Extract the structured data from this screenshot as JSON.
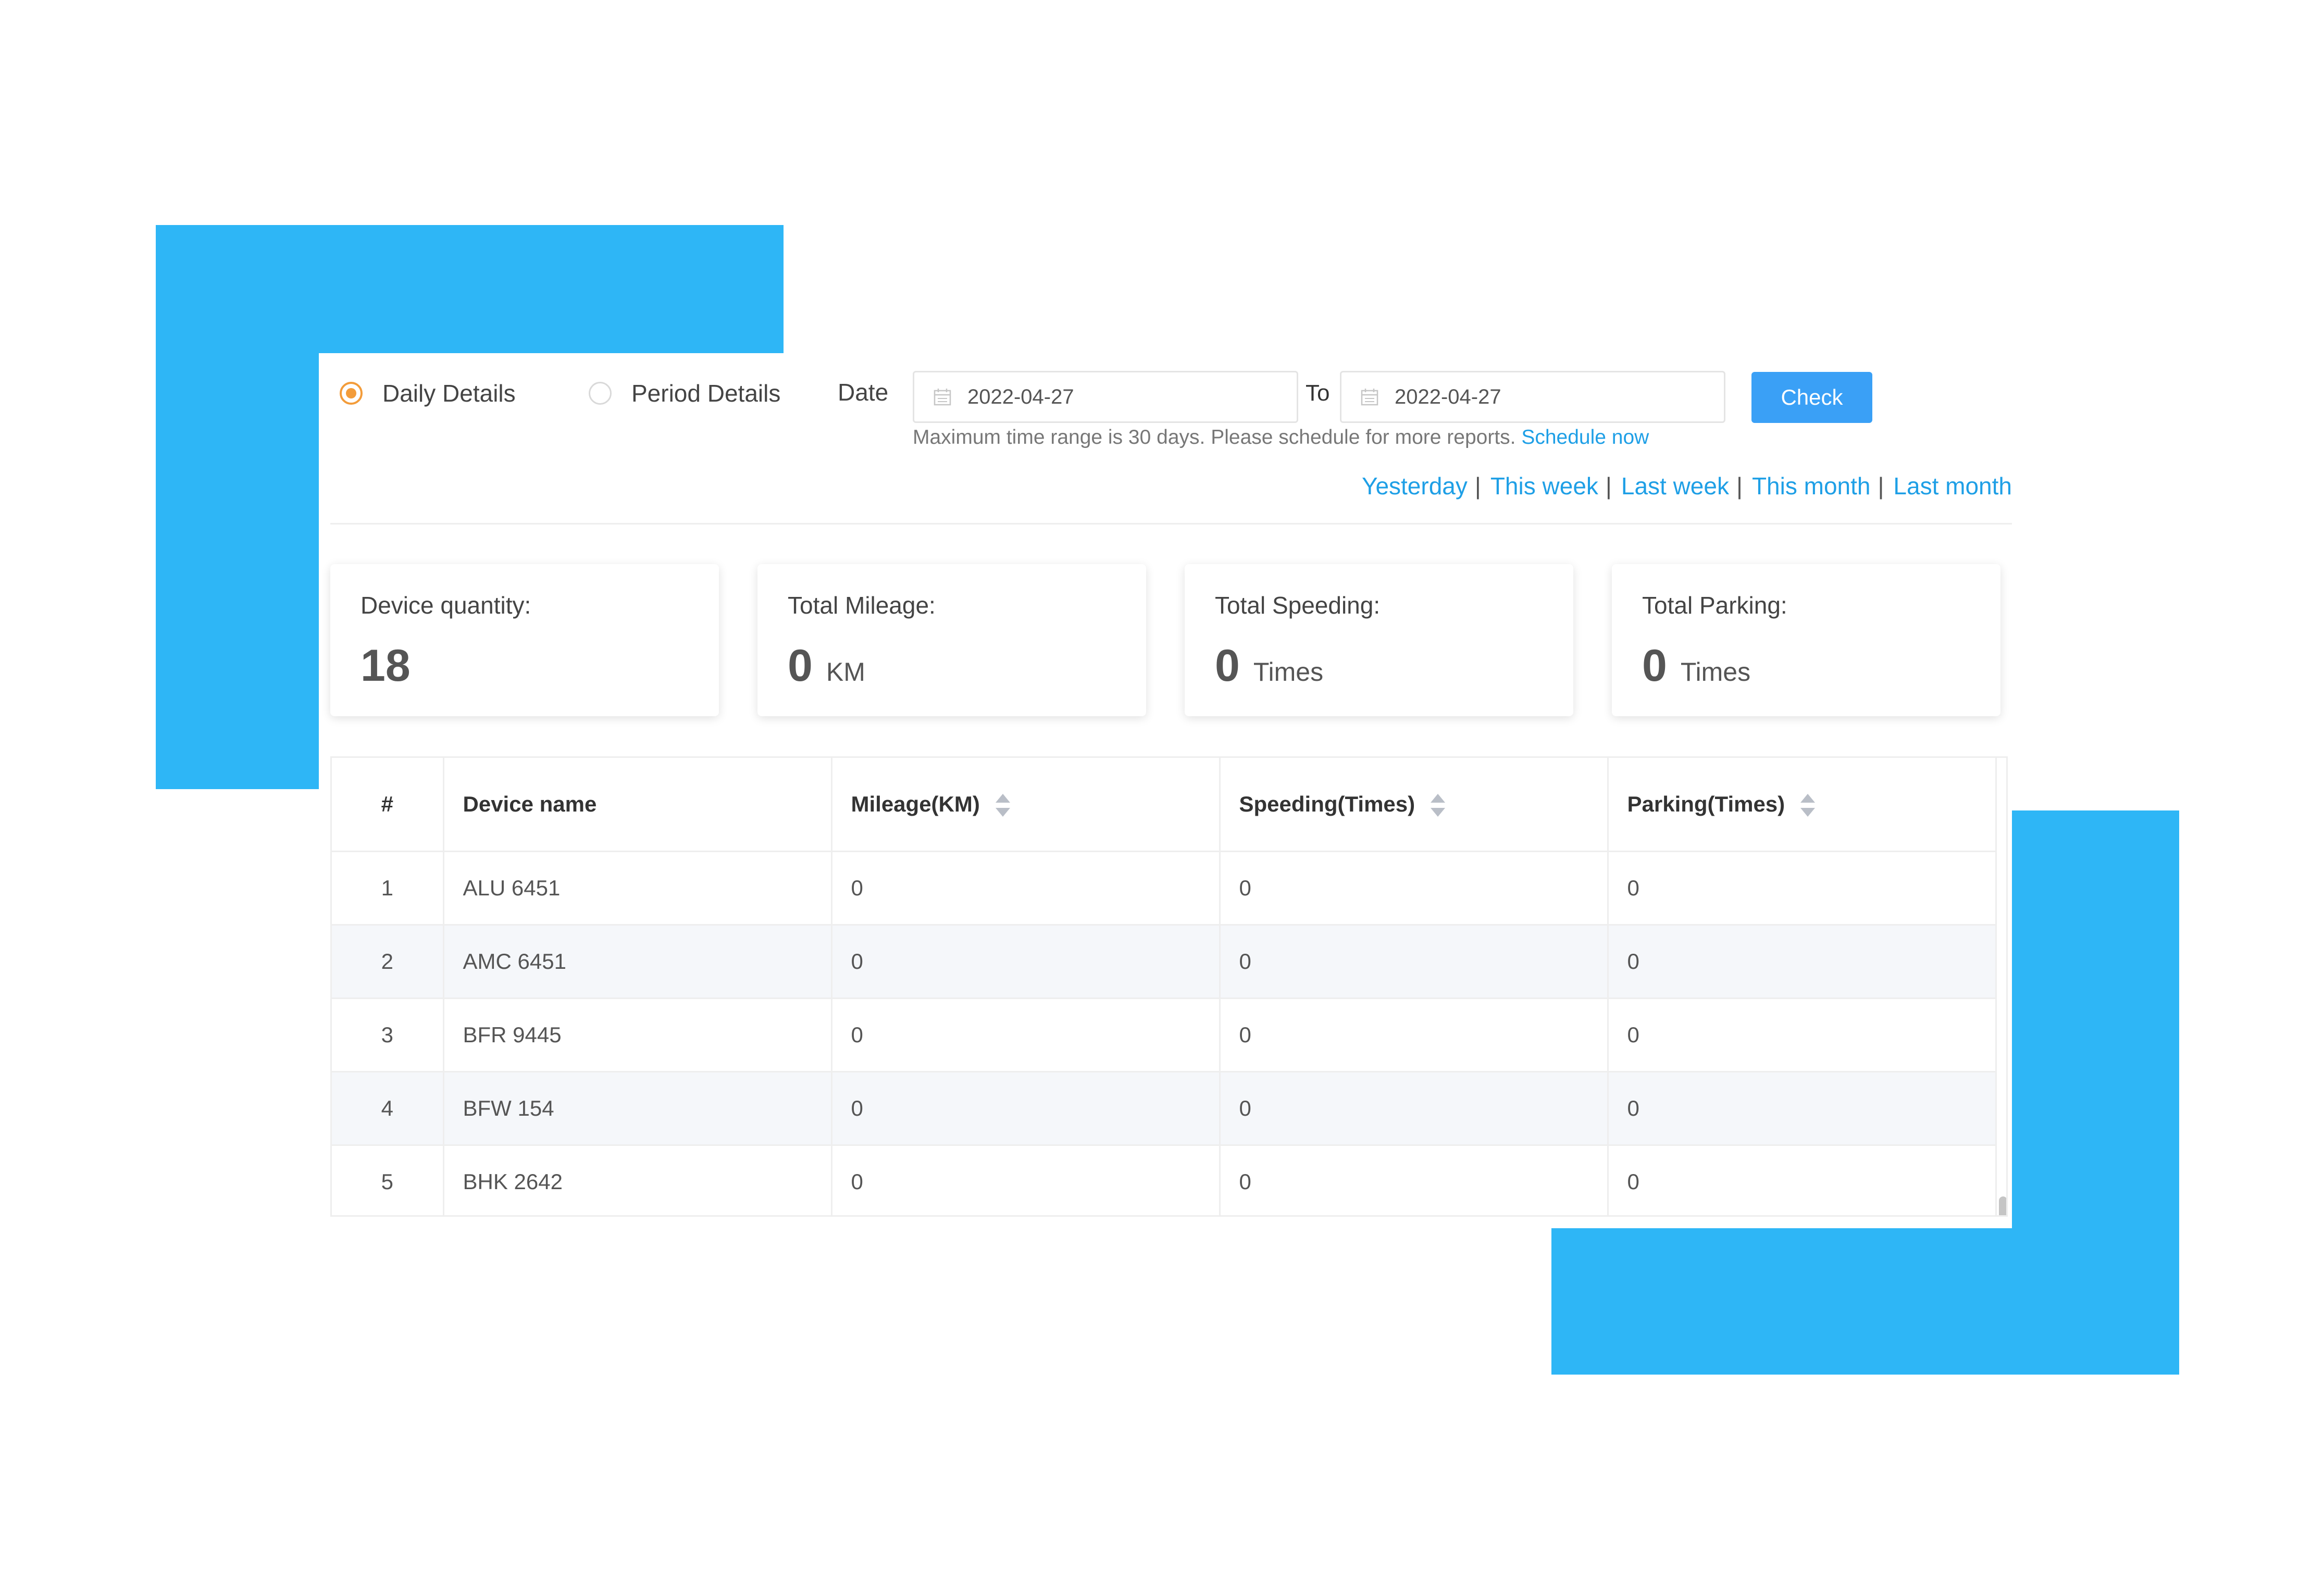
{
  "filters": {
    "radio_daily": "Daily Details",
    "radio_period": "Period Details",
    "date_label": "Date",
    "date_from": "2022-04-27",
    "to_label": "To",
    "date_to": "2022-04-27",
    "check_button": "Check",
    "hint_text": "Maximum time range is 30 days. Please schedule for more reports.",
    "schedule_link": "Schedule now",
    "quick_ranges": [
      "Yesterday",
      "This week",
      "Last week",
      "This month",
      "Last month"
    ],
    "selected_mode": "Daily Details"
  },
  "summary": {
    "devices": {
      "label": "Device quantity:",
      "value": "18"
    },
    "mileage": {
      "label": "Total Mileage:",
      "value": "0",
      "unit": "KM"
    },
    "speeding": {
      "label": "Total Speeding:",
      "value": "0",
      "unit": "Times"
    },
    "parking": {
      "label": "Total Parking:",
      "value": "0",
      "unit": "Times"
    }
  },
  "table": {
    "headers": [
      "#",
      "Device name",
      "Mileage(KM)",
      "Speeding(Times)",
      "Parking(Times)"
    ],
    "rows": [
      [
        "1",
        "ALU 6451",
        "0",
        "0",
        "0"
      ],
      [
        "2",
        "AMC 6451",
        "0",
        "0",
        "0"
      ],
      [
        "3",
        "BFR 9445",
        "0",
        "0",
        "0"
      ],
      [
        "4",
        "BFW 154",
        "0",
        "0",
        "0"
      ],
      [
        "5",
        "BHK 2642",
        "0",
        "0",
        "0"
      ]
    ]
  },
  "colors": {
    "accent_blue": "#2eb6f6",
    "button_blue": "#3aa0f6",
    "link_blue": "#1e9fe6",
    "radio_orange": "#f39c3a"
  },
  "icons": {
    "date_input": "calendar-icon",
    "sort": "sort-icon"
  }
}
